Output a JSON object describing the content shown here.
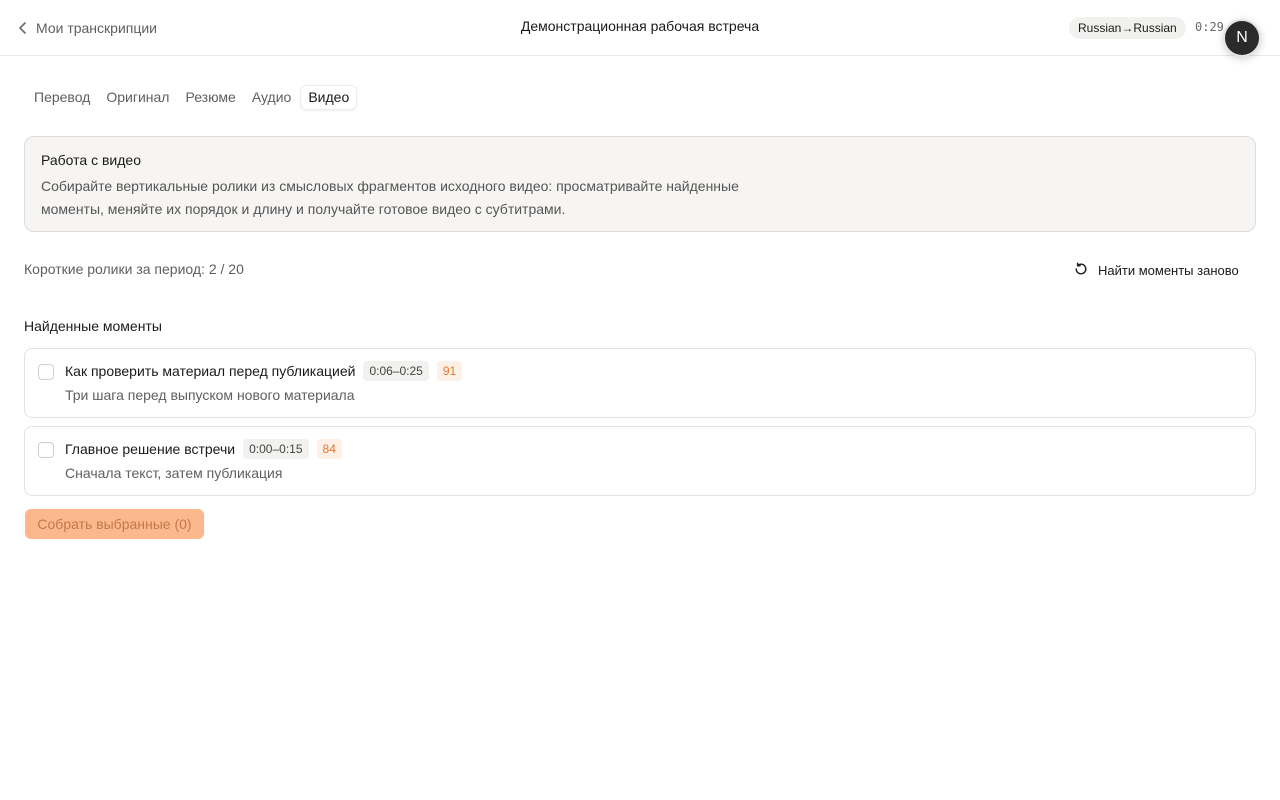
{
  "header": {
    "back_label": "Мои транскрипции",
    "title": "Демонстрационная рабочая встреча",
    "language_badge": "Russian→Russian",
    "timer": "0:29",
    "avatar_letter": "N"
  },
  "tabs": [
    {
      "label": "Перевод",
      "active": false
    },
    {
      "label": "Оригинал",
      "active": false
    },
    {
      "label": "Резюме",
      "active": false
    },
    {
      "label": "Аудио",
      "active": false
    },
    {
      "label": "Видео",
      "active": true
    }
  ],
  "info": {
    "title": "Работа с видео",
    "text": "Собирайте вертикальные ролики из смысловых фрагментов исходного видео: просматривайте найденные моменты, меняйте их порядок и длину и получайте готовое видео с субтитрами."
  },
  "quota": {
    "label": "Короткие ролики за период: 2 / 20"
  },
  "refind_label": "Найти моменты заново",
  "moments_section_title": "Найденные моменты",
  "moments": [
    {
      "title": "Как проверить материал перед публикацией",
      "time_range": "0:06–0:25",
      "score": "91",
      "subtitle": "Три шага перед выпуском нового материала",
      "checked": false
    },
    {
      "title": "Главное решение встречи",
      "time_range": "0:00–0:15",
      "score": "84",
      "subtitle": "Сначала текст, затем публикация",
      "checked": false
    }
  ],
  "build_button_label": "Собрать выбранные (0)",
  "colors": {
    "accent": "#fcb88d",
    "score_text": "#e8772e",
    "info_bg": "#f6f5f3"
  },
  "icons": {
    "back": "chevron-left-icon",
    "refind": "refresh-icon"
  }
}
